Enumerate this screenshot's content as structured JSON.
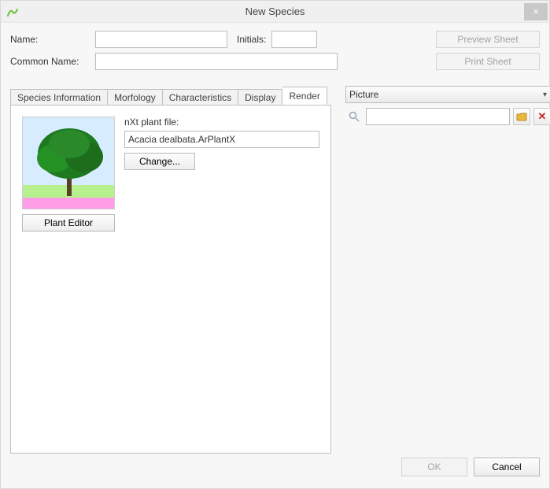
{
  "window": {
    "title": "New Species",
    "close_icon": "×"
  },
  "form": {
    "name_label": "Name:",
    "name_value": "",
    "initials_label": "Initials:",
    "initials_value": "",
    "common_label": "Common Name:",
    "common_value": ""
  },
  "side_buttons": {
    "preview": "Preview Sheet",
    "print": "Print Sheet"
  },
  "tabs": {
    "items": [
      {
        "label": "Species Information"
      },
      {
        "label": "Morfology"
      },
      {
        "label": "Characteristics"
      },
      {
        "label": "Display"
      },
      {
        "label": "Render"
      }
    ],
    "active_index": 4
  },
  "render_tab": {
    "nxt_label": "nXt plant file:",
    "nxt_value": "Acacia dealbata.ArPlantX",
    "change_label": "Change...",
    "plant_editor_label": "Plant Editor"
  },
  "picture_panel": {
    "selector_value": "Picture",
    "path_value": "",
    "search_icon": "search-icon",
    "browse_icon": "folder-icon",
    "delete_icon": "delete-icon"
  },
  "footer": {
    "ok": "OK",
    "cancel": "Cancel"
  }
}
